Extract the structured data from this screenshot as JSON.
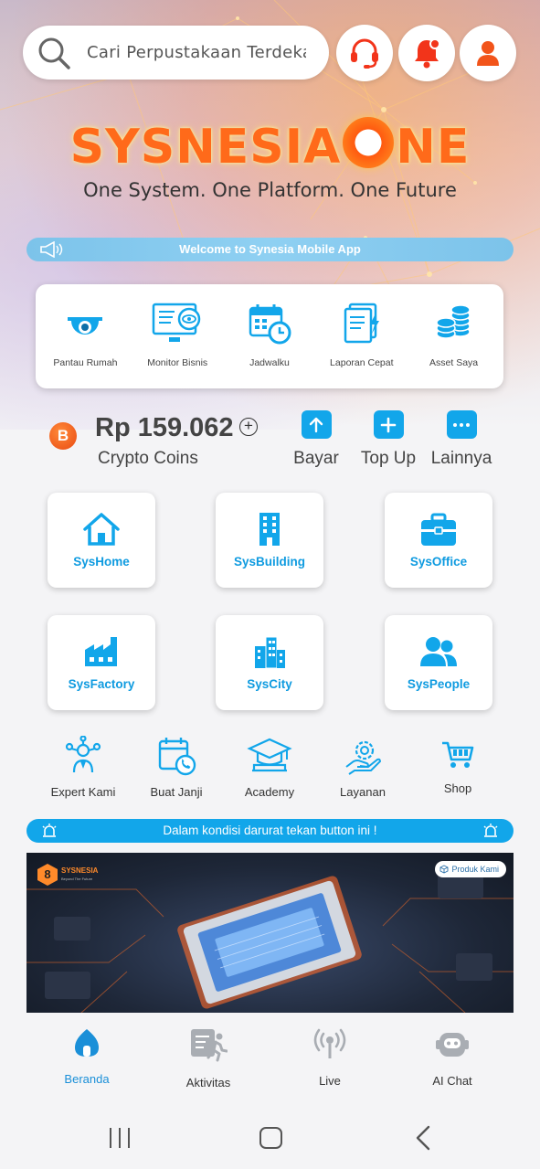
{
  "search": {
    "placeholder": "Cari Perpustakaan Terdekat"
  },
  "header_icons": [
    "search-icon",
    "headset-icon",
    "bell-icon",
    "user-icon"
  ],
  "brand": {
    "logo_text_left": "SYSNESIA",
    "logo_text_right": "NE",
    "tagline": "One System. One Platform. One Future"
  },
  "welcome_banner": "Welcome to Synesia Mobile App",
  "quick_menu": [
    {
      "label": "Pantau Rumah",
      "icon": "cctv-camera-icon"
    },
    {
      "label": "Monitor Bisnis",
      "icon": "monitor-eye-icon"
    },
    {
      "label": "Jadwalku",
      "icon": "calendar-clock-icon"
    },
    {
      "label": "Laporan Cepat",
      "icon": "document-lightning-icon"
    },
    {
      "label": "Asset Saya",
      "icon": "coin-stack-icon"
    }
  ],
  "wallet": {
    "currency_symbol": "B",
    "amount": "Rp 159.062",
    "label": "Crypto Coins",
    "actions": [
      {
        "label": "Bayar",
        "icon": "arrow-up-icon"
      },
      {
        "label": "Top Up",
        "icon": "plus-icon"
      },
      {
        "label": "Lainnya",
        "icon": "more-dots-icon"
      }
    ]
  },
  "services": [
    {
      "label": "SysHome",
      "icon": "house-icon"
    },
    {
      "label": "SysBuilding",
      "icon": "building-icon"
    },
    {
      "label": "SysOffice",
      "icon": "briefcase-icon"
    },
    {
      "label": "SysFactory",
      "icon": "factory-icon"
    },
    {
      "label": "SysCity",
      "icon": "city-icon"
    },
    {
      "label": "SysPeople",
      "icon": "people-icon"
    }
  ],
  "shortcuts": [
    {
      "label": "Expert Kami",
      "icon": "expert-network-icon"
    },
    {
      "label": "Buat Janji",
      "icon": "calendar-phone-icon"
    },
    {
      "label": "Academy",
      "icon": "graduation-cap-icon"
    },
    {
      "label": "Layanan",
      "icon": "gear-hand-icon"
    },
    {
      "label": "Shop",
      "icon": "cart-icon"
    }
  ],
  "emergency_banner": "Dalam kondisi darurat tekan button ini !",
  "promo": {
    "brand_mark": "8",
    "brand_name": "SYSNESIA",
    "brand_sub": "Beyond The Future",
    "badge": "Produk Kami"
  },
  "bottom_nav": [
    {
      "label": "Beranda",
      "icon": "home-icon",
      "active": true
    },
    {
      "label": "Aktivitas",
      "icon": "activity-runner-icon",
      "active": false
    },
    {
      "label": "Live",
      "icon": "broadcast-icon",
      "active": false
    },
    {
      "label": "AI Chat",
      "icon": "robot-icon",
      "active": false
    }
  ],
  "colors": {
    "accent": "#12a6ea",
    "brand_orange": "#ff6a1a",
    "tile_text": "#0f9be0"
  }
}
